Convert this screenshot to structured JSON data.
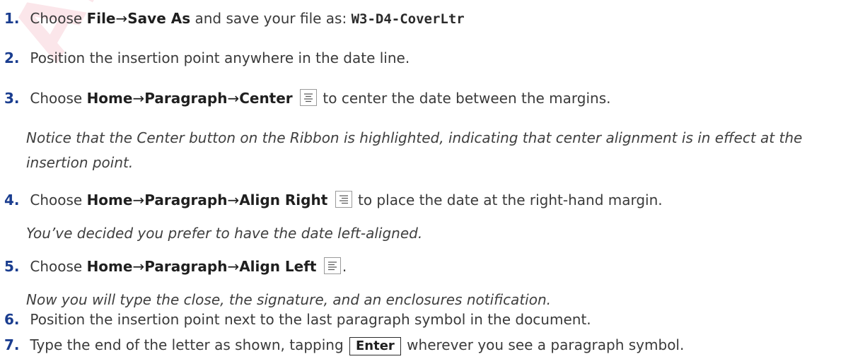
{
  "watermark": "ALL",
  "steps": [
    {
      "num": "1.",
      "choose": "Choose",
      "file": "File",
      "saveas": "Save As",
      "rest": "and save your file as:",
      "filename": "W3-D4-CoverLtr"
    },
    {
      "num": "2.",
      "text": "Position the insertion point anywhere in the date line."
    },
    {
      "num": "3.",
      "choose": "Choose",
      "home": "Home",
      "paragraph": "Paragraph",
      "command": "Center",
      "icon": "align-center-icon",
      "rest": "to center the date between the margins.",
      "note": "Notice that the Center button on the Ribbon is highlighted, indicating that center alignment is in effect at the insertion point."
    },
    {
      "num": "4.",
      "choose": "Choose",
      "home": "Home",
      "paragraph": "Paragraph",
      "command": "Align Right",
      "icon": "align-right-icon",
      "rest": "to place the date at the right-hand margin.",
      "note": "You’ve decided you prefer to have the date left-aligned."
    },
    {
      "num": "5.",
      "choose": "Choose",
      "home": "Home",
      "paragraph": "Paragraph",
      "command": "Align Left",
      "icon": "align-left-icon",
      "rest": ".",
      "note": "Now you will type the close, the signature, and an enclosures notification."
    },
    {
      "num": "6.",
      "text": "Position the insertion point next to the last paragraph symbol in the document."
    },
    {
      "num": "7.",
      "text1": "Type the end of the letter as shown, tapping",
      "key": "Enter",
      "text2": "wherever you see a paragraph symbol."
    }
  ],
  "arrow": "→"
}
